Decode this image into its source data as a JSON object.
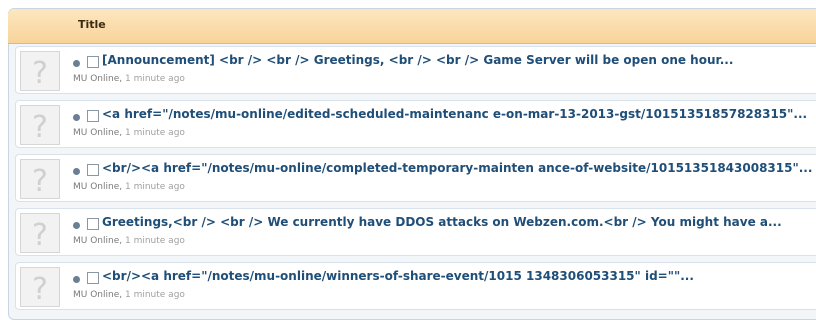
{
  "header": {
    "title": "Title"
  },
  "threads": [
    {
      "title": "[Announcement] <br /> <br /> Greetings, <br /> <br /> Game Server will be open one hour...",
      "author": "MU Online",
      "time": "1 minute ago"
    },
    {
      "title": "<a href=\"/notes/mu-online/edited-scheduled-maintenanc e-on-mar-13-2013-gst/10151351857828315\"...",
      "author": "MU Online",
      "time": "1 minute ago"
    },
    {
      "title": "<br/><a href=\"/notes/mu-online/completed-temporary-mainten ance-of-website/10151351843008315\"...",
      "author": "MU Online",
      "time": "1 minute ago"
    },
    {
      "title": "Greetings,<br /> <br /> We currently have DDOS attacks on Webzen.com.<br /> You might have a...",
      "author": "MU Online",
      "time": "1 minute ago"
    },
    {
      "title": "<br/><a href=\"/notes/mu-online/winners-of-share-event/1015 1348306053315\" id=\"\"...",
      "author": "MU Online",
      "time": "1 minute ago"
    }
  ]
}
